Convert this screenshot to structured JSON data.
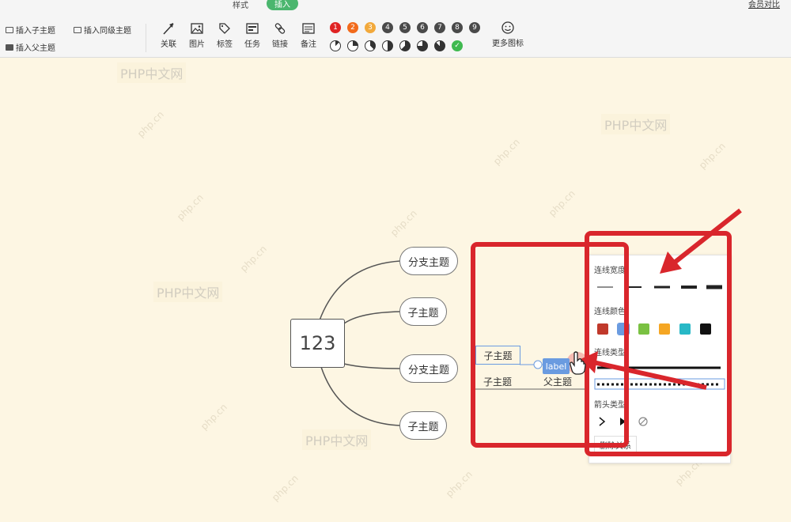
{
  "tabs": [
    {
      "label": "样式",
      "active": false
    },
    {
      "label": "插入",
      "active": true
    }
  ],
  "top_right_link": "会员对比",
  "insert_buttons": {
    "insert_child": "插入子主题",
    "insert_sibling": "插入同级主题",
    "insert_parent": "插入父主题"
  },
  "tools": [
    {
      "label": "关联",
      "icon": "arrow-icon"
    },
    {
      "label": "图片",
      "icon": "image-icon"
    },
    {
      "label": "标签",
      "icon": "tag-icon"
    },
    {
      "label": "任务",
      "icon": "task-icon"
    },
    {
      "label": "链接",
      "icon": "link-icon"
    },
    {
      "label": "备注",
      "icon": "note-icon"
    }
  ],
  "priority_badges": [
    {
      "label": "1",
      "color": "#e02424"
    },
    {
      "label": "2",
      "color": "#f26a1b"
    },
    {
      "label": "3",
      "color": "#f2a93b"
    },
    {
      "label": "4",
      "color": "#4a4a4a"
    },
    {
      "label": "5",
      "color": "#4a4a4a"
    },
    {
      "label": "6",
      "color": "#4a4a4a"
    },
    {
      "label": "7",
      "color": "#4a4a4a"
    },
    {
      "label": "8",
      "color": "#4a4a4a"
    },
    {
      "label": "9",
      "color": "#4a4a4a"
    }
  ],
  "progress_icons": [
    {
      "fraction": 0.125
    },
    {
      "fraction": 0.25
    },
    {
      "fraction": 0.375
    },
    {
      "fraction": 0.5
    },
    {
      "fraction": 0.625
    },
    {
      "fraction": 0.75
    },
    {
      "fraction": 0.875
    },
    {
      "fraction": 1.0,
      "complete": true
    }
  ],
  "more_icons_label": "更多图标",
  "watermark_text": "PHP中文网",
  "watermark_small": "php.cn",
  "mindmap": {
    "root": "123",
    "branches": [
      "分支主题",
      "子主题",
      "分支主题",
      "子主题"
    ],
    "floating": {
      "child_selected": "子主题",
      "child_line": "子主题",
      "parent": "父主题",
      "label_tag": "label"
    }
  },
  "line_panel": {
    "width_label": "连线宽度",
    "color_label": "连线颜色",
    "type_label": "连线类型",
    "arrow_label": "箭头类型",
    "delete_label": "删除关系",
    "colors": [
      "#c0392b",
      "#6a9be0",
      "#7ac142",
      "#f5a623",
      "#28b8c6",
      "#111111"
    ],
    "selected_color_index": 1
  }
}
